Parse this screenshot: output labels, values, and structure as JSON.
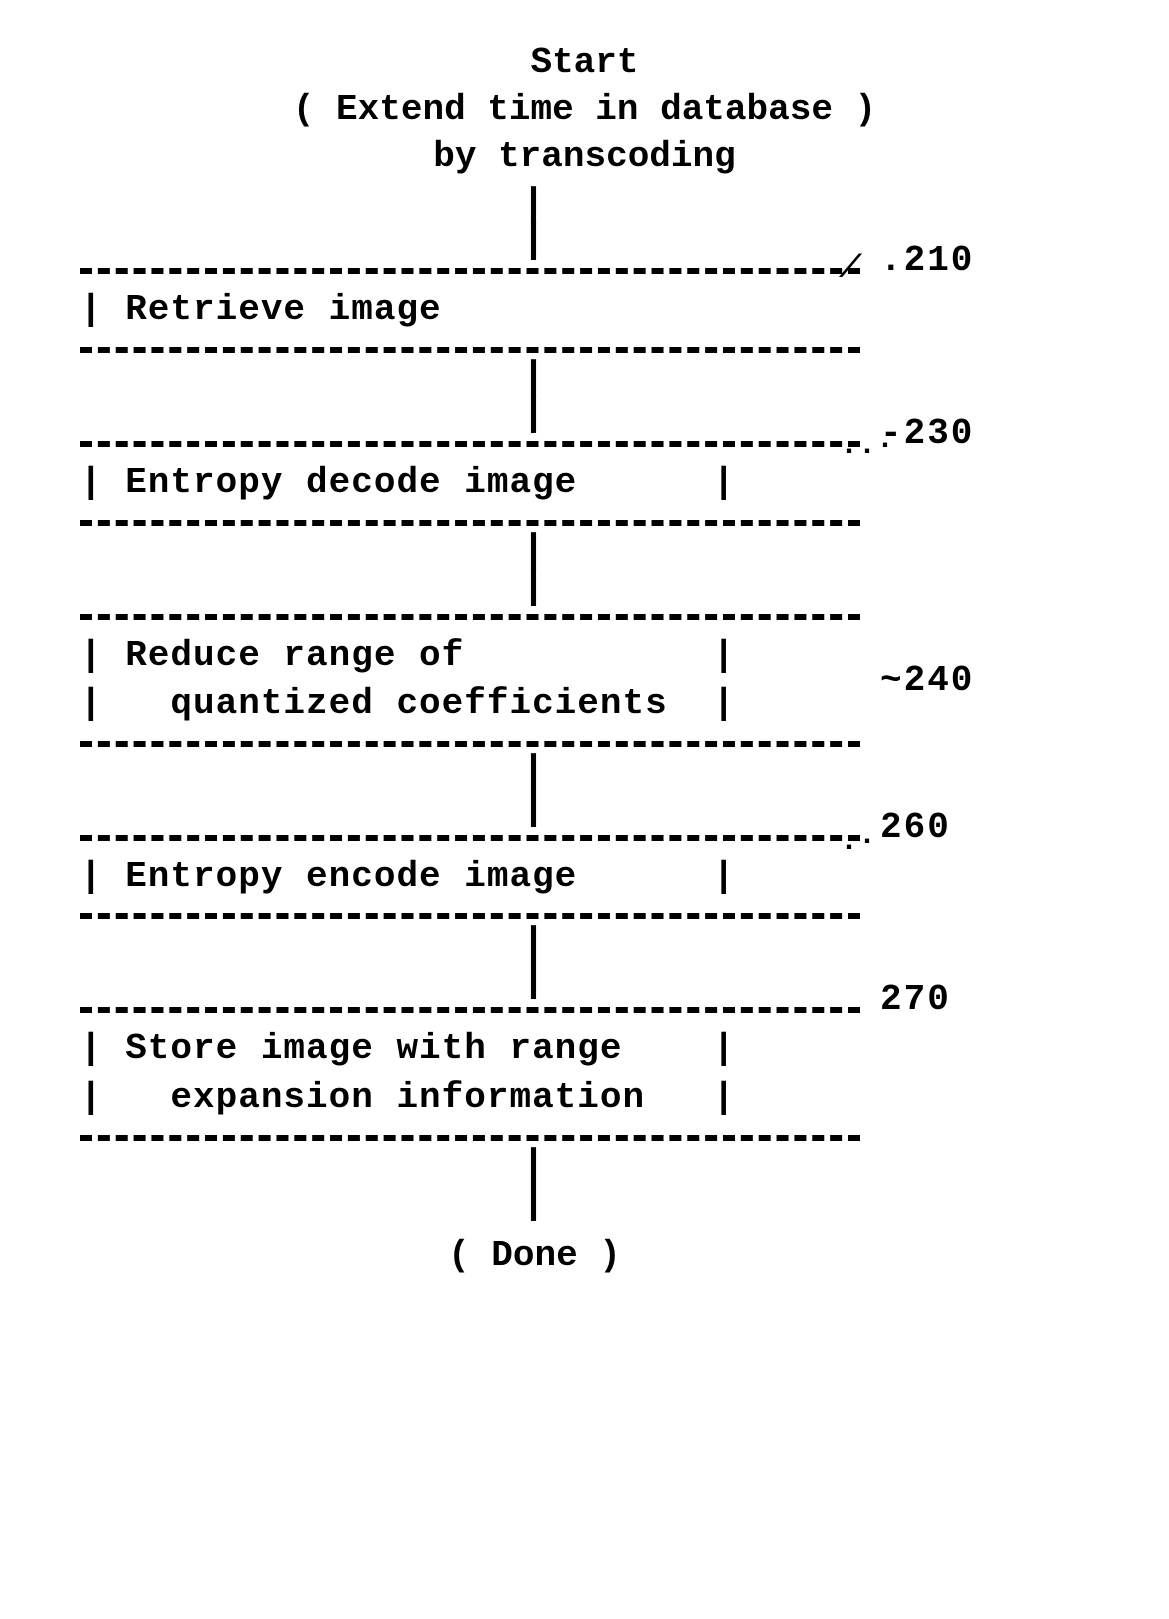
{
  "chart_data": {
    "type": "flowchart",
    "title": "Start",
    "subtitle": "( Extend time in database )\nby transcoding",
    "steps": [
      {
        "ref": "210",
        "text": [
          "| Retrieve image"
        ]
      },
      {
        "ref": "230",
        "text": [
          "| Entropy decode image      |"
        ]
      },
      {
        "ref": "240",
        "text": [
          "| Reduce range of           |",
          "|   quantized coefficients  |"
        ]
      },
      {
        "ref": "260",
        "text": [
          "| Entropy encode image      |"
        ]
      },
      {
        "ref": "270",
        "text": [
          "| Store image with range    |",
          "|   expansion information   |"
        ]
      }
    ],
    "end": "(  Done  )"
  },
  "connector": "|\n|",
  "refs": {
    "r0": ".210",
    "r1": "-230",
    "r2": "~240",
    "r3": "260",
    "r4": "270"
  },
  "leads": {
    "l0": "⟋",
    "l1": "..·",
    "l3": ".·"
  }
}
